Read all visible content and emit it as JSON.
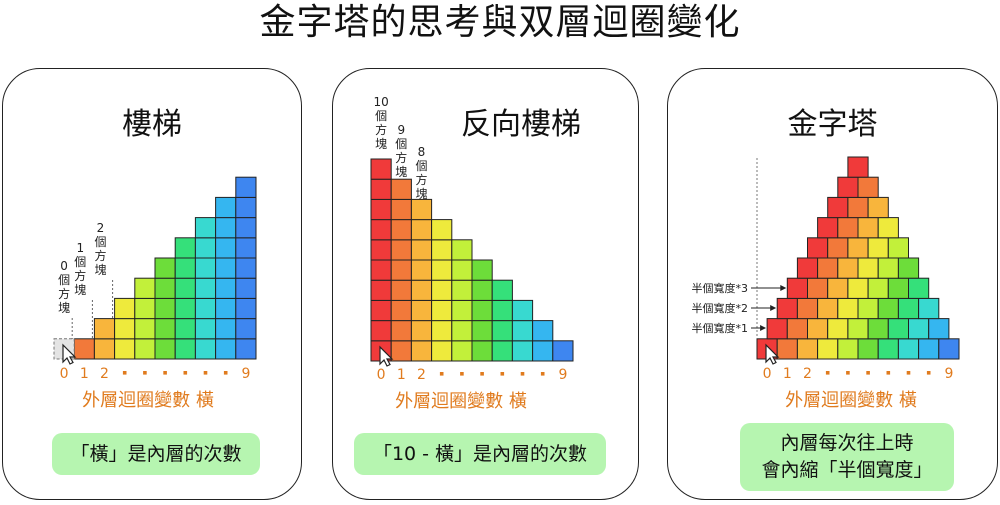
{
  "title": "金字塔的思考與双層迴圈變化",
  "panels": [
    {
      "title": "樓梯",
      "caption": "「橫」是內層的次數"
    },
    {
      "title": "反向樓梯",
      "caption": "「10 - 橫」是內層的次數"
    },
    {
      "title": "金字塔",
      "caption_line1": "內層每次往上時",
      "caption_line2": "會內縮「半個寬度」"
    }
  ],
  "axis": {
    "tick_first": [
      "0",
      "1",
      "2"
    ],
    "tick_last": "9",
    "label": "外層迴圈變數 橫",
    "color": "#e07b1e"
  },
  "stair": {
    "counts": [
      0,
      1,
      2,
      3,
      4,
      5,
      6,
      7,
      8,
      9
    ],
    "annotations": [
      {
        "index": 0,
        "number": "0",
        "unit_chars": [
          "個",
          "方",
          "塊"
        ]
      },
      {
        "index": 1,
        "number": "1",
        "unit_chars": [
          "個",
          "方",
          "塊"
        ]
      },
      {
        "index": 2,
        "number": "2",
        "unit_chars": [
          "個",
          "方",
          "塊"
        ]
      }
    ]
  },
  "reverse_stair": {
    "counts": [
      10,
      9,
      8,
      7,
      6,
      5,
      4,
      3,
      2,
      1
    ],
    "annotations": [
      {
        "index": 0,
        "number": "10",
        "unit_chars": [
          "個",
          "方",
          "塊"
        ]
      },
      {
        "index": 1,
        "number": "9",
        "unit_chars": [
          "個",
          "方",
          "塊"
        ]
      },
      {
        "index": 2,
        "number": "8",
        "unit_chars": [
          "個",
          "方",
          "塊"
        ]
      }
    ]
  },
  "pyramid": {
    "rows": [
      10,
      9,
      8,
      7,
      6,
      5,
      4,
      3,
      2,
      1
    ],
    "offset_labels": [
      "半個寬度*1",
      "半個寬度*2",
      "半個寬度*3"
    ]
  },
  "column_colors": [
    "#f03a3a",
    "#f2793a",
    "#f8b53c",
    "#eeea3c",
    "#c2f03a",
    "#6ddd3a",
    "#35e07a",
    "#38d9d0",
    "#35b6f0",
    "#3e86f0"
  ],
  "empty_cell_color": "#e4e4e4",
  "arrow_color": "#222222"
}
